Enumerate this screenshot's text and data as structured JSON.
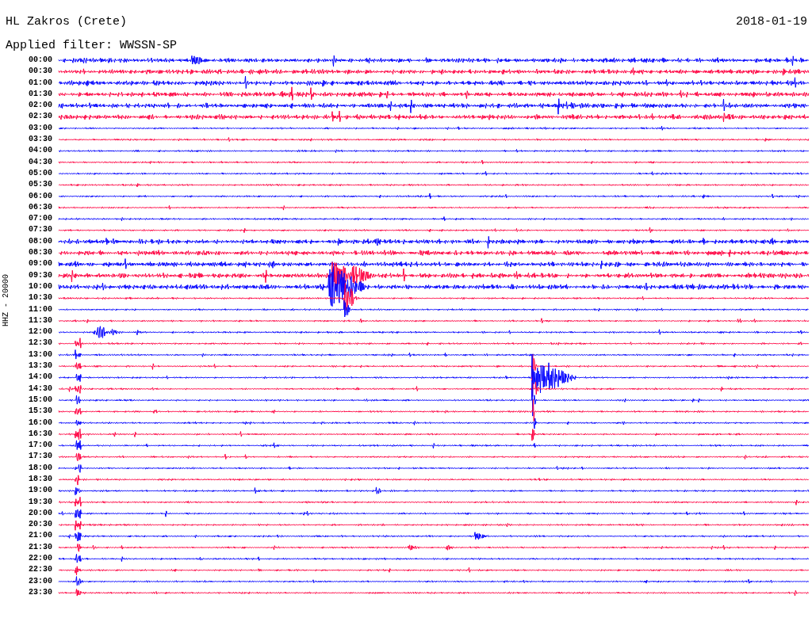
{
  "station": "HL Zakros (Crete)",
  "date": "2018-01-19",
  "filter": "Applied filter: WWSSN-SP",
  "channel_label": "HHZ - 20000",
  "rows": [
    {
      "time": "00:00",
      "color": "#0000ff"
    },
    {
      "time": "00:30",
      "color": "#ff0040"
    },
    {
      "time": "01:00",
      "color": "#0000ff"
    },
    {
      "time": "01:30",
      "color": "#ff0040"
    },
    {
      "time": "02:00",
      "color": "#0000ff"
    },
    {
      "time": "02:30",
      "color": "#ff0040"
    },
    {
      "time": "03:00",
      "color": "#0000ff"
    },
    {
      "time": "03:30",
      "color": "#ff0040"
    },
    {
      "time": "04:00",
      "color": "#0000ff"
    },
    {
      "time": "04:30",
      "color": "#ff0040"
    },
    {
      "time": "05:00",
      "color": "#0000ff"
    },
    {
      "time": "05:30",
      "color": "#ff0040"
    },
    {
      "time": "06:00",
      "color": "#0000ff"
    },
    {
      "time": "06:30",
      "color": "#ff0040"
    },
    {
      "time": "07:00",
      "color": "#0000ff"
    },
    {
      "time": "07:30",
      "color": "#ff0040"
    },
    {
      "time": "08:00",
      "color": "#0000ff"
    },
    {
      "time": "08:30",
      "color": "#ff0040"
    },
    {
      "time": "09:00",
      "color": "#0000ff"
    },
    {
      "time": "09:30",
      "color": "#ff0040"
    },
    {
      "time": "10:00",
      "color": "#0000ff"
    },
    {
      "time": "10:30",
      "color": "#ff0040"
    },
    {
      "time": "11:00",
      "color": "#0000ff"
    },
    {
      "time": "11:30",
      "color": "#ff0040"
    },
    {
      "time": "12:00",
      "color": "#0000ff"
    },
    {
      "time": "12:30",
      "color": "#ff0040"
    },
    {
      "time": "13:00",
      "color": "#0000ff"
    },
    {
      "time": "13:30",
      "color": "#ff0040"
    },
    {
      "time": "14:00",
      "color": "#0000ff"
    },
    {
      "time": "14:30",
      "color": "#ff0040"
    },
    {
      "time": "15:00",
      "color": "#0000ff"
    },
    {
      "time": "15:30",
      "color": "#ff0040"
    },
    {
      "time": "16:00",
      "color": "#0000ff"
    },
    {
      "time": "16:30",
      "color": "#ff0040"
    },
    {
      "time": "17:00",
      "color": "#0000ff"
    },
    {
      "time": "17:30",
      "color": "#ff0040"
    },
    {
      "time": "18:00",
      "color": "#0000ff"
    },
    {
      "time": "18:30",
      "color": "#ff0040"
    },
    {
      "time": "19:00",
      "color": "#0000ff"
    },
    {
      "time": "19:30",
      "color": "#ff0040"
    },
    {
      "time": "20:00",
      "color": "#0000ff"
    },
    {
      "time": "20:30",
      "color": "#ff0040"
    },
    {
      "time": "21:00",
      "color": "#0000ff"
    },
    {
      "time": "21:30",
      "color": "#ff0040"
    },
    {
      "time": "22:00",
      "color": "#0000ff"
    },
    {
      "time": "22:30",
      "color": "#ff0040"
    },
    {
      "time": "23:00",
      "color": "#0000ff"
    },
    {
      "time": "23:30",
      "color": "#ff0040"
    }
  ]
}
